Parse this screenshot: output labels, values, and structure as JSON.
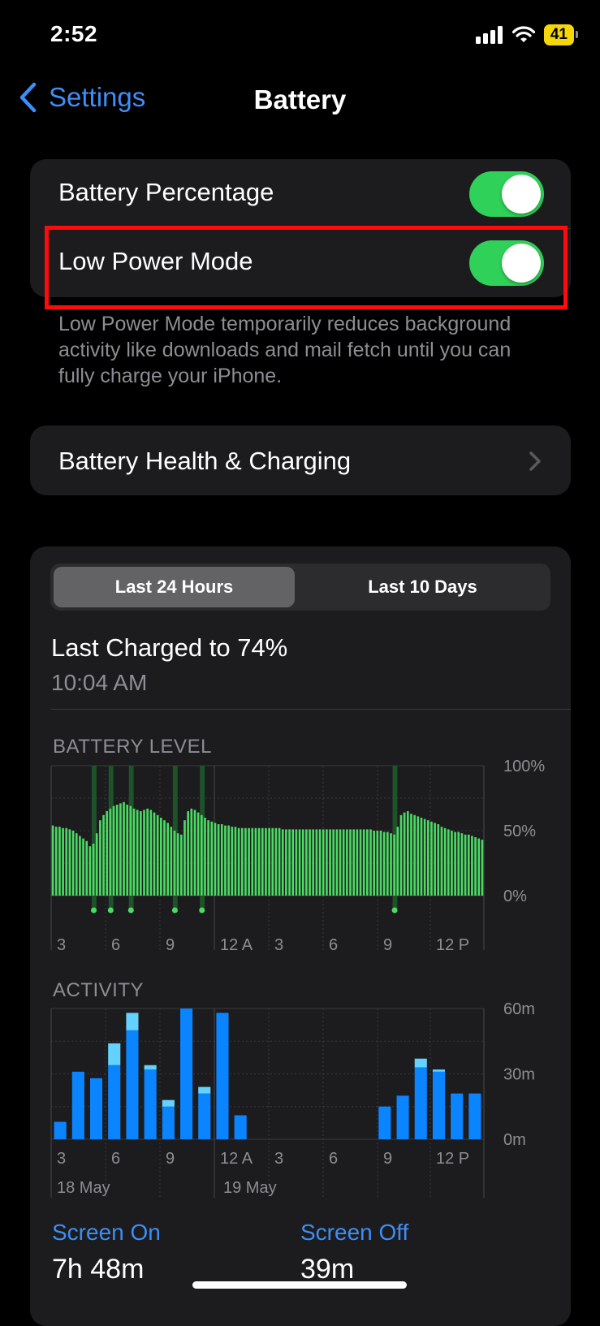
{
  "status_bar": {
    "time": "2:52",
    "battery_level": "41",
    "icons": [
      "signal-bars-icon",
      "wifi-icon",
      "battery-icon"
    ]
  },
  "nav": {
    "back_label": "Settings",
    "title": "Battery"
  },
  "settings": {
    "battery_percentage": {
      "label": "Battery Percentage",
      "on": true
    },
    "low_power_mode": {
      "label": "Low Power Mode",
      "on": true
    },
    "footnote": "Low Power Mode temporarily reduces background activity like downloads and mail fetch until you can fully charge your iPhone.",
    "battery_health": {
      "label": "Battery Health & Charging"
    }
  },
  "usage": {
    "tabs": [
      {
        "label": "Last 24 Hours",
        "selected": true
      },
      {
        "label": "Last 10 Days",
        "selected": false
      }
    ],
    "last_charged": "Last Charged to 74%",
    "last_charged_time": "10:04 AM",
    "battery_level_title": "BATTERY LEVEL",
    "activity_title": "ACTIVITY",
    "date_labels": [
      "18 May",
      "19 May"
    ],
    "screen_on": {
      "label": "Screen On",
      "value": "7h 48m"
    },
    "screen_off": {
      "label": "Screen Off",
      "value": "39m"
    }
  },
  "colors": {
    "accent": "#3e8ef7",
    "toggle_on": "#30d158",
    "battery_bar": "#4cd964",
    "activity_screen_on": "#0a84ff",
    "activity_screen_off": "#64d2ff",
    "highlight": "#ff0b0b"
  },
  "chart_data": [
    {
      "type": "bar",
      "title": "BATTERY LEVEL",
      "x_tick_labels": [
        "3",
        "6",
        "9",
        "12 A",
        "3",
        "6",
        "9",
        "12 P"
      ],
      "y_tick_labels": [
        "100%",
        "50%",
        "0%"
      ],
      "ylim": [
        0,
        100
      ],
      "values": [
        54,
        53,
        53,
        52,
        52,
        51,
        50,
        48,
        46,
        44,
        42,
        38,
        40,
        48,
        58,
        62,
        65,
        67,
        69,
        70,
        71,
        72,
        70,
        69,
        67,
        66,
        65,
        66,
        67,
        66,
        64,
        62,
        60,
        58,
        56,
        53,
        50,
        48,
        47,
        58,
        65,
        67,
        66,
        64,
        62,
        60,
        58,
        57,
        56,
        55,
        55,
        54,
        54,
        53,
        53,
        52,
        52,
        52,
        52,
        52,
        52,
        52,
        52,
        52,
        52,
        52,
        52,
        52,
        51,
        51,
        51,
        51,
        51,
        51,
        51,
        51,
        51,
        51,
        51,
        51,
        51,
        51,
        51,
        51,
        51,
        51,
        51,
        51,
        51,
        51,
        51,
        51,
        51,
        51,
        51,
        50,
        50,
        50,
        49,
        49,
        48,
        47,
        53,
        62,
        64,
        65,
        63,
        62,
        61,
        60,
        59,
        58,
        57,
        56,
        55,
        53,
        52,
        51,
        50,
        49,
        49,
        48,
        47,
        47,
        46,
        45,
        44,
        43
      ],
      "charging_indices": [
        12,
        17,
        23,
        36,
        44,
        101
      ]
    },
    {
      "type": "bar",
      "title": "ACTIVITY",
      "x_tick_labels": [
        "3",
        "6",
        "9",
        "12 A",
        "3",
        "6",
        "9",
        "12 P"
      ],
      "y_tick_labels": [
        "60m",
        "30m",
        "0m"
      ],
      "ylim": [
        0,
        60
      ],
      "categories": [
        "02:00",
        "03:00",
        "04:00",
        "05:00",
        "06:00",
        "07:00",
        "08:00",
        "09:00",
        "10:00",
        "11:00",
        "12:00",
        "13:00",
        "14:00",
        "15:00",
        "16:00",
        "17:00",
        "18:00",
        "19:00",
        "20:00",
        "21:00",
        "22:00",
        "23:00",
        "00:00",
        "01:00"
      ],
      "series": [
        {
          "values": [
            8,
            31,
            28,
            34,
            50,
            32,
            15,
            60,
            21,
            58,
            11,
            0,
            0,
            0,
            0,
            0,
            0,
            0,
            15,
            20,
            33,
            31,
            21,
            21
          ]
        },
        {
          "values": [
            0,
            0,
            0,
            10,
            8,
            2,
            3,
            0,
            3,
            0,
            0,
            0,
            0,
            0,
            0,
            0,
            0,
            0,
            0,
            0,
            4,
            1,
            0,
            0
          ]
        }
      ]
    }
  ]
}
